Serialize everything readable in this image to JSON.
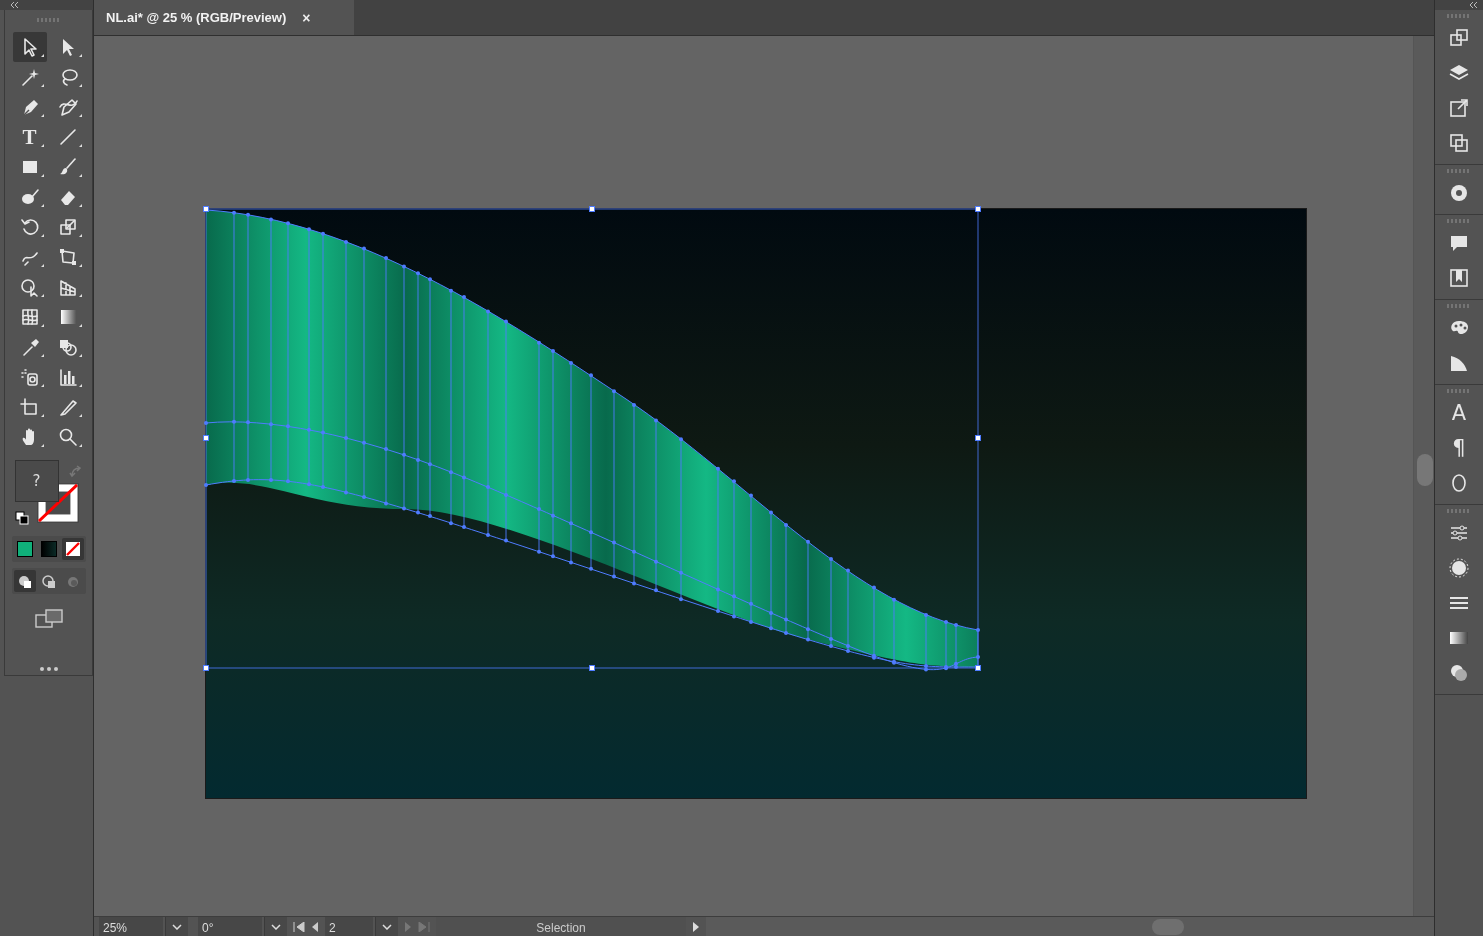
{
  "document_tab": {
    "title": "NL.ai* @ 25 % (RGB/Preview)",
    "close": "×",
    "selected": true
  },
  "tools": [
    {
      "selected": true
    },
    {
      "selected": false
    },
    {
      "selected": false
    },
    {
      "selected": false
    },
    {
      "selected": false
    },
    {
      "selected": false
    },
    {
      "selected": false,
      "glyph": "T"
    },
    {
      "selected": false
    },
    {
      "selected": false
    },
    {
      "selected": false
    },
    {
      "selected": false
    },
    {
      "selected": false
    },
    {
      "selected": false
    },
    {
      "selected": false
    },
    {
      "selected": false
    },
    {
      "selected": false
    },
    {
      "selected": false
    },
    {
      "selected": false
    },
    {
      "selected": false
    },
    {
      "selected": false
    },
    {
      "selected": false
    },
    {
      "selected": false
    },
    {
      "selected": false
    },
    {
      "selected": false
    },
    {
      "selected": false
    },
    {
      "selected": false
    },
    {
      "selected": false
    },
    {
      "selected": false
    }
  ],
  "fill_stroke": {
    "fill_label": "?"
  },
  "color_modes": [
    {
      "kind": "color",
      "color": "#10b07a",
      "selected": false
    },
    {
      "kind": "gradient",
      "color": "#0b2a26",
      "selected": false
    },
    {
      "kind": "none",
      "selected": true
    }
  ],
  "draw_modes": [
    {
      "selected": true
    },
    {
      "selected": false
    },
    {
      "selected": false
    }
  ],
  "right_panel": {
    "glyphs": [
      "A",
      "¶"
    ]
  },
  "status_bar": {
    "zoom": "25%",
    "rotation": "0°",
    "artboard": "2",
    "tool": "Selection"
  }
}
